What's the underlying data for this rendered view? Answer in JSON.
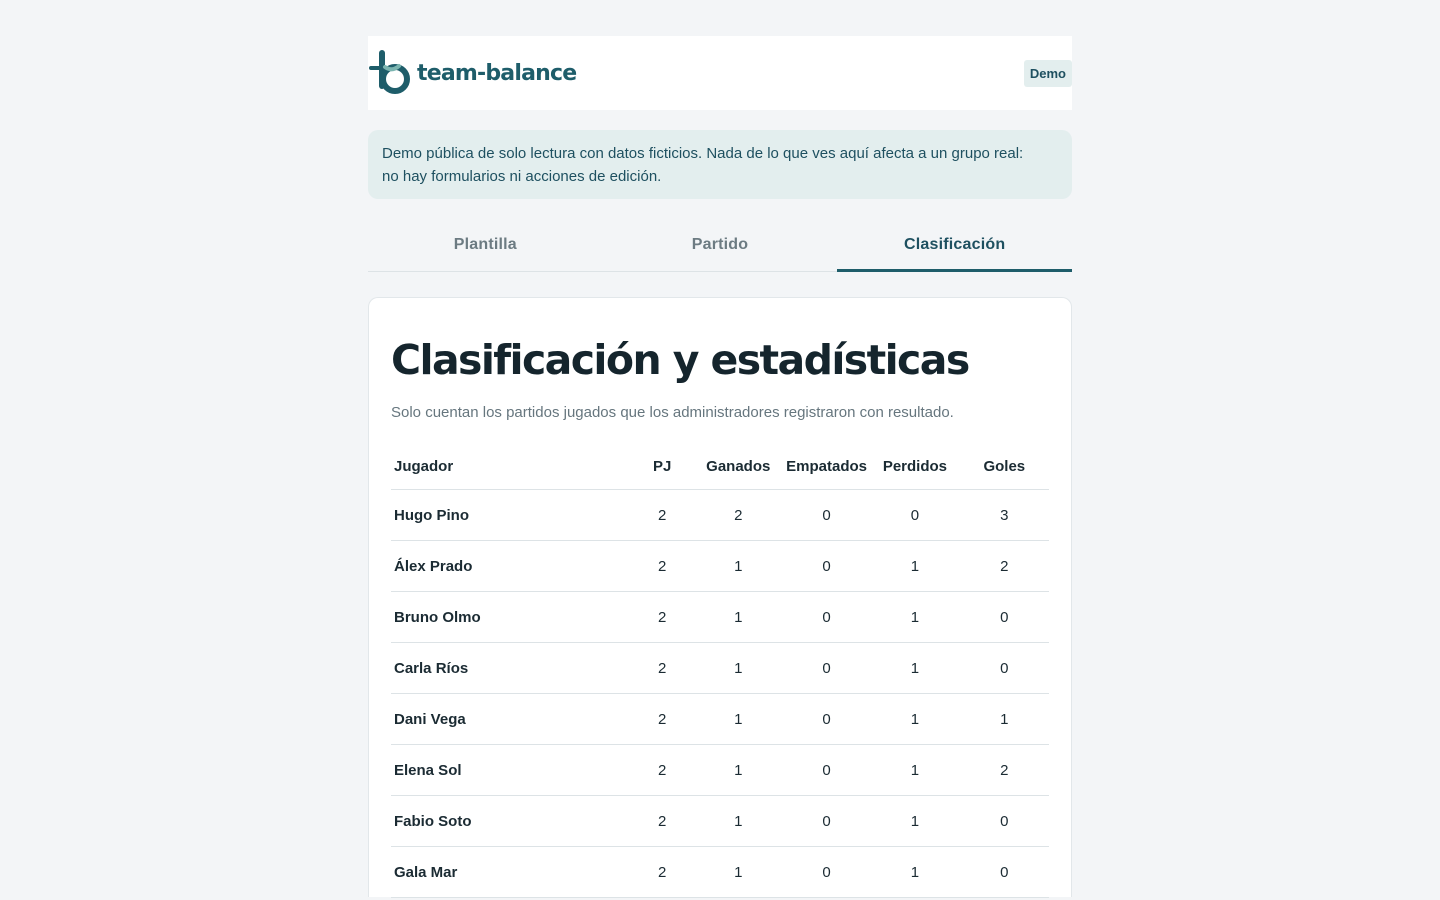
{
  "header": {
    "logo_text": "team-balance",
    "badge": "Demo"
  },
  "notice": {
    "line1": "Demo pública de solo lectura con datos ficticios. Nada de lo que ves aquí afecta a un grupo real:",
    "line2": "no hay formularios ni acciones de edición."
  },
  "tabs": [
    {
      "label": "Plantilla",
      "active": false
    },
    {
      "label": "Partido",
      "active": false
    },
    {
      "label": "Clasificación",
      "active": true
    }
  ],
  "main": {
    "title": "Clasificación y estadísticas",
    "subtitle": "Solo cuentan los partidos jugados que los administradores registraron con resultado."
  },
  "table": {
    "headers": [
      "Jugador",
      "PJ",
      "Ganados",
      "Empatados",
      "Perdidos",
      "Goles"
    ],
    "rows": [
      [
        "Hugo Pino",
        "2",
        "2",
        "0",
        "0",
        "3"
      ],
      [
        "Álex Prado",
        "2",
        "1",
        "0",
        "1",
        "2"
      ],
      [
        "Bruno Olmo",
        "2",
        "1",
        "0",
        "1",
        "0"
      ],
      [
        "Carla Ríos",
        "2",
        "1",
        "0",
        "1",
        "0"
      ],
      [
        "Dani Vega",
        "2",
        "1",
        "0",
        "1",
        "1"
      ],
      [
        "Elena Sol",
        "2",
        "1",
        "0",
        "1",
        "2"
      ],
      [
        "Fabio Soto",
        "2",
        "1",
        "0",
        "1",
        "0"
      ],
      [
        "Gala Mar",
        "2",
        "1",
        "0",
        "1",
        "0"
      ]
    ]
  },
  "colors": {
    "brand": "#1e5d6a",
    "notice_bg": "#e3eeee",
    "page_bg": "#f3f5f7"
  },
  "icons": {
    "logo": "team-balance-logo-icon"
  }
}
